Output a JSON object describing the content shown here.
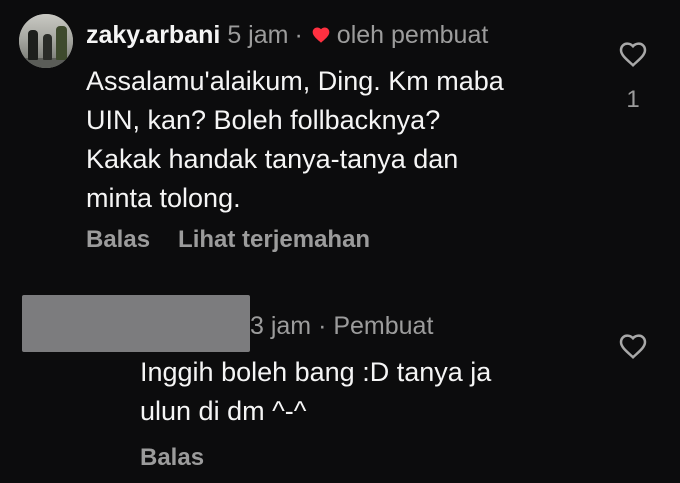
{
  "comment": {
    "username": "zaky.arbani",
    "time": "5 jam",
    "separator": "·",
    "liked_by_creator_label": "oleh pembuat",
    "text": "Assalamu'alaikum, Ding. Km maba\nUIN, kan? Boleh follbacknya?\nKakak handak tanya-tanya dan\nminta tolong.",
    "reply_label": "Balas",
    "translate_label": "Lihat terjemahan",
    "like_count": "1",
    "heart_color": "#ff3040"
  },
  "reply": {
    "time_and_author": "3 jam · Pembuat",
    "text": "Inggih boleh bang :D tanya ja\nulun di dm ^-^",
    "reply_label": "Balas"
  },
  "icons": {
    "like": "heart-outline-icon",
    "liked_by_creator": "heart-filled-icon"
  }
}
